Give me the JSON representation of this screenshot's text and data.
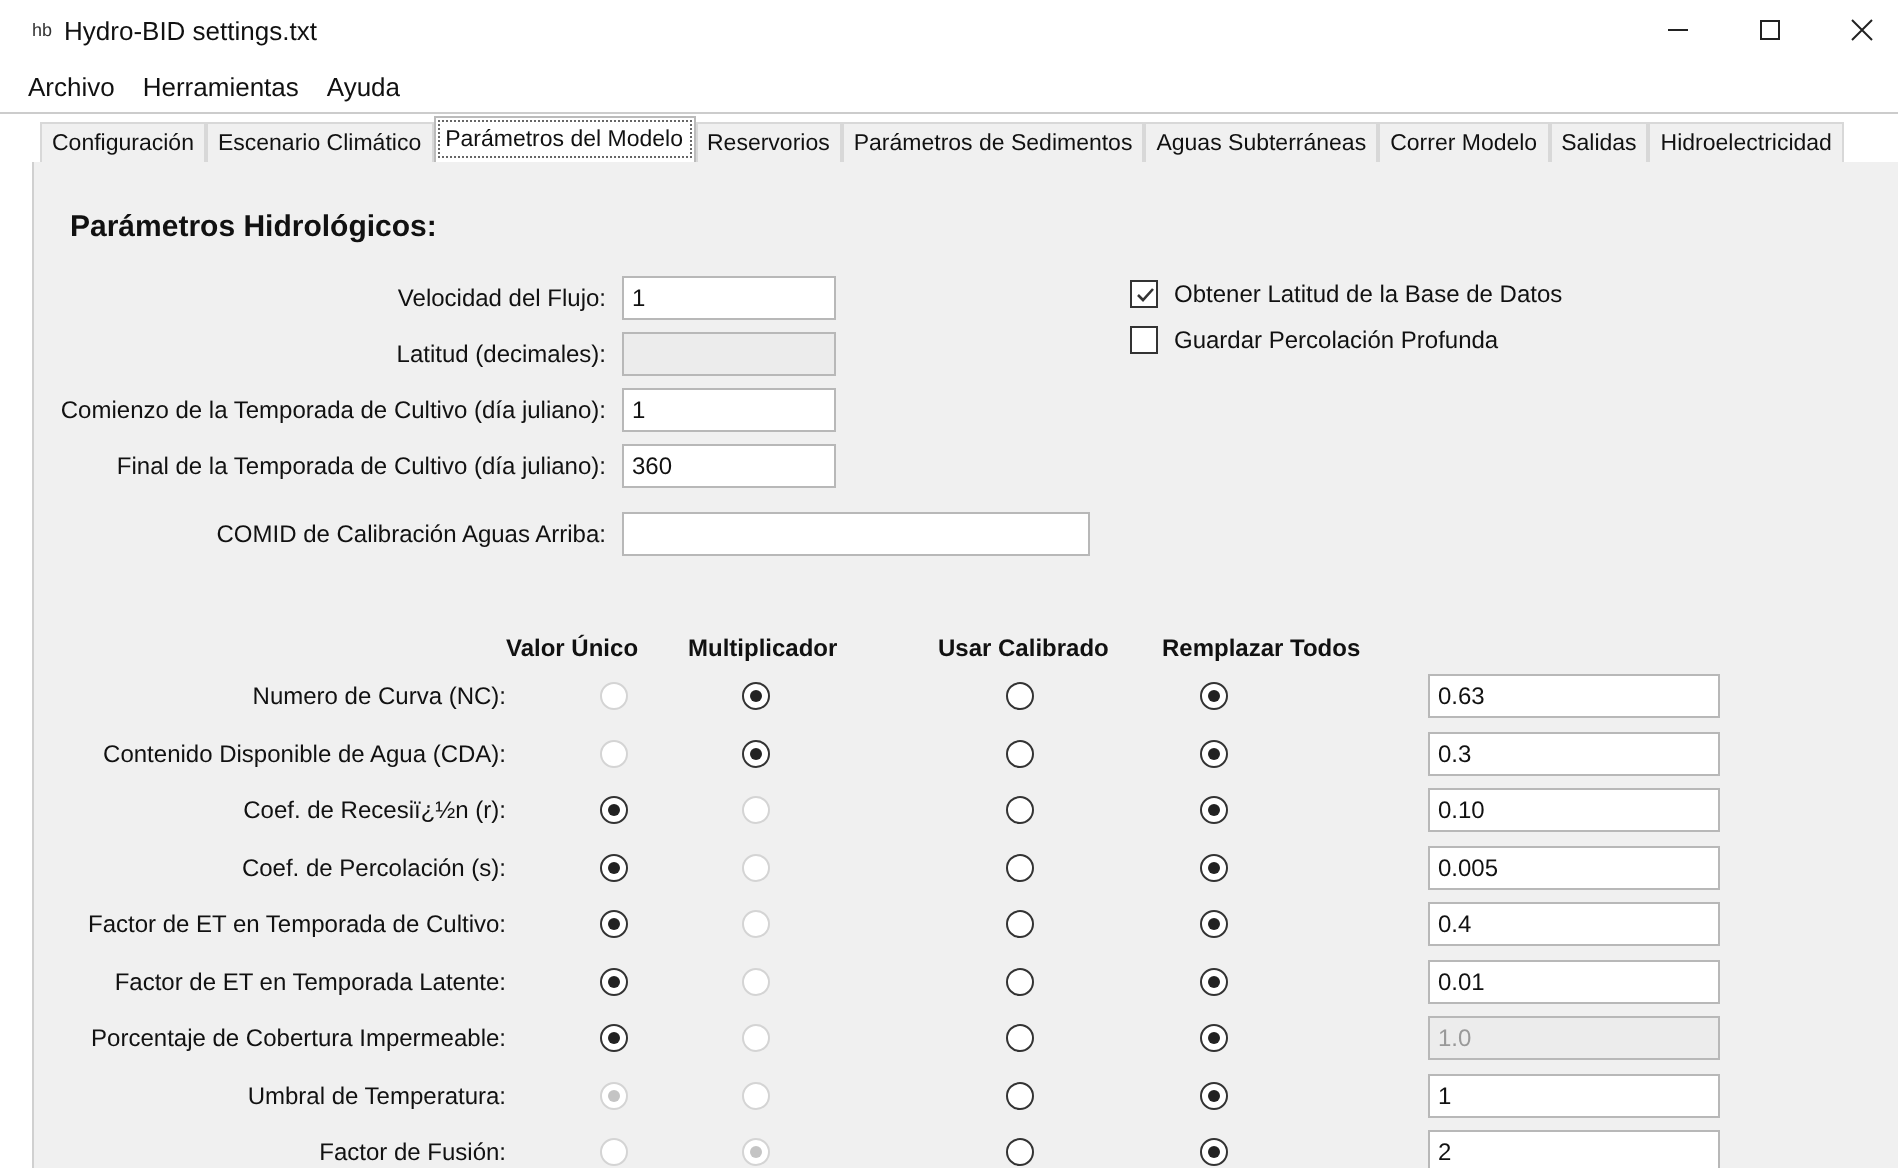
{
  "window": {
    "app_icon": "hb",
    "title": "Hydro-BID settings.txt"
  },
  "menu": [
    "Archivo",
    "Herramientas",
    "Ayuda"
  ],
  "tabs": [
    {
      "label": "Configuración",
      "selected": false
    },
    {
      "label": "Escenario Climático",
      "selected": false
    },
    {
      "label": "Parámetros del Modelo",
      "selected": true
    },
    {
      "label": "Reservorios",
      "selected": false
    },
    {
      "label": "Parámetros de Sedimentos",
      "selected": false
    },
    {
      "label": "Aguas Subterráneas",
      "selected": false
    },
    {
      "label": "Correr Modelo",
      "selected": false
    },
    {
      "label": "Salidas",
      "selected": false
    },
    {
      "label": "Hidroelectricidad",
      "selected": false
    }
  ],
  "section_title": "Parámetros Hidrológicos:",
  "fields": [
    {
      "label": "Velocidad del Flujo:",
      "value": "1",
      "disabled": false,
      "wide": false
    },
    {
      "label": "Latitud (decimales):",
      "disabled": true,
      "wide": false
    },
    {
      "label": "Comienzo de la Temporada de Cultivo (día juliano):",
      "value": "1",
      "disabled": false,
      "wide": false
    },
    {
      "label": "Final de la Temporada de Cultivo (día juliano):",
      "value": "360",
      "disabled": false,
      "wide": false
    },
    {
      "label": "COMID de Calibración Aguas Arriba:",
      "disabled": false,
      "wide": true
    }
  ],
  "checkboxes": [
    {
      "label": "Obtener Latitud de la Base de Datos",
      "checked": true
    },
    {
      "label": "Guardar Percolación Profunda",
      "checked": false
    }
  ],
  "table": {
    "columns": [
      "Valor Único",
      "Multiplicador",
      "Usar Calibrado",
      "Remplazar Todos"
    ],
    "rows": [
      {
        "label": "Numero de Curva (NC):",
        "options": [
          {
            "selected": false,
            "disabled": true
          },
          {
            "selected": true,
            "disabled": false
          },
          {
            "selected": false,
            "disabled": false
          },
          {
            "selected": true,
            "disabled": false
          }
        ],
        "value": "0.63",
        "value_disabled": false
      },
      {
        "label": "Contenido Disponible de Agua (CDA):",
        "options": [
          {
            "selected": false,
            "disabled": true
          },
          {
            "selected": true,
            "disabled": false
          },
          {
            "selected": false,
            "disabled": false
          },
          {
            "selected": true,
            "disabled": false
          }
        ],
        "value": "0.3",
        "value_disabled": false
      },
      {
        "label": "Coef. de Recesiï¿½n (r):",
        "options": [
          {
            "selected": true,
            "disabled": false
          },
          {
            "selected": false,
            "disabled": true
          },
          {
            "selected": false,
            "disabled": false
          },
          {
            "selected": true,
            "disabled": false
          }
        ],
        "value": "0.10",
        "value_disabled": false
      },
      {
        "label": "Coef. de Percolación (s):",
        "options": [
          {
            "selected": true,
            "disabled": false
          },
          {
            "selected": false,
            "disabled": true
          },
          {
            "selected": false,
            "disabled": false
          },
          {
            "selected": true,
            "disabled": false
          }
        ],
        "value": "0.005",
        "value_disabled": false
      },
      {
        "label": "Factor de ET en Temporada de Cultivo:",
        "options": [
          {
            "selected": true,
            "disabled": false
          },
          {
            "selected": false,
            "disabled": true
          },
          {
            "selected": false,
            "disabled": false
          },
          {
            "selected": true,
            "disabled": false
          }
        ],
        "value": "0.4",
        "value_disabled": false
      },
      {
        "label": "Factor de ET en Temporada Latente:",
        "options": [
          {
            "selected": true,
            "disabled": false
          },
          {
            "selected": false,
            "disabled": true
          },
          {
            "selected": false,
            "disabled": false
          },
          {
            "selected": true,
            "disabled": false
          }
        ],
        "value": "0.01",
        "value_disabled": false
      },
      {
        "label": "Porcentaje de Cobertura Impermeable:",
        "options": [
          {
            "selected": true,
            "disabled": false
          },
          {
            "selected": false,
            "disabled": true
          },
          {
            "selected": false,
            "disabled": false
          },
          {
            "selected": true,
            "disabled": false
          }
        ],
        "value": "1.0",
        "value_disabled": true
      },
      {
        "label": "Umbral de Temperatura:",
        "options": [
          {
            "selected": true,
            "disabled": true
          },
          {
            "selected": false,
            "disabled": true
          },
          {
            "selected": false,
            "disabled": false
          },
          {
            "selected": true,
            "disabled": false
          }
        ],
        "value": "1",
        "value_disabled": false
      },
      {
        "label": "Factor de Fusión:",
        "options": [
          {
            "selected": false,
            "disabled": true
          },
          {
            "selected": true,
            "disabled": true
          },
          {
            "selected": false,
            "disabled": false
          },
          {
            "selected": true,
            "disabled": false
          }
        ],
        "value": "2",
        "value_disabled": false
      }
    ]
  }
}
